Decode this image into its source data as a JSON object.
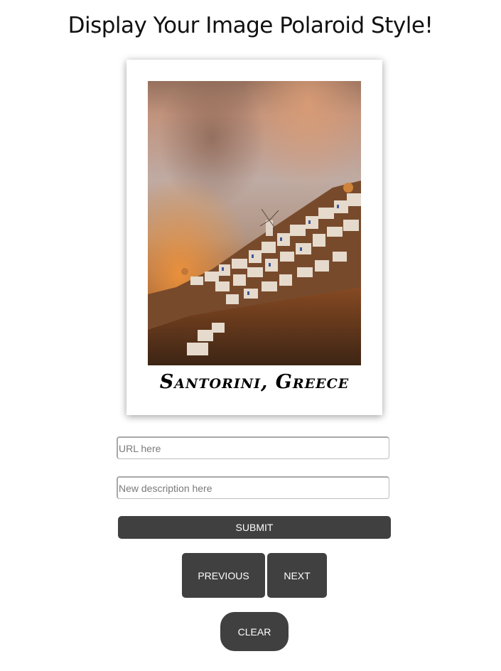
{
  "header": {
    "title": "Display Your Image Polaroid Style!"
  },
  "polaroid": {
    "caption": "Santorini, Greece",
    "photo_subject": "Santorini village on hillside at sunset with windmill"
  },
  "form": {
    "url_placeholder": "URL here",
    "description_placeholder": "New description here",
    "submit_label": "SUBMIT"
  },
  "navigation": {
    "previous_label": "PREVIOUS",
    "next_label": "NEXT",
    "clear_label": "CLEAR"
  },
  "colors": {
    "button_bg": "#404040",
    "button_text": "#ffffff",
    "polaroid_frame": "#ffffff"
  }
}
